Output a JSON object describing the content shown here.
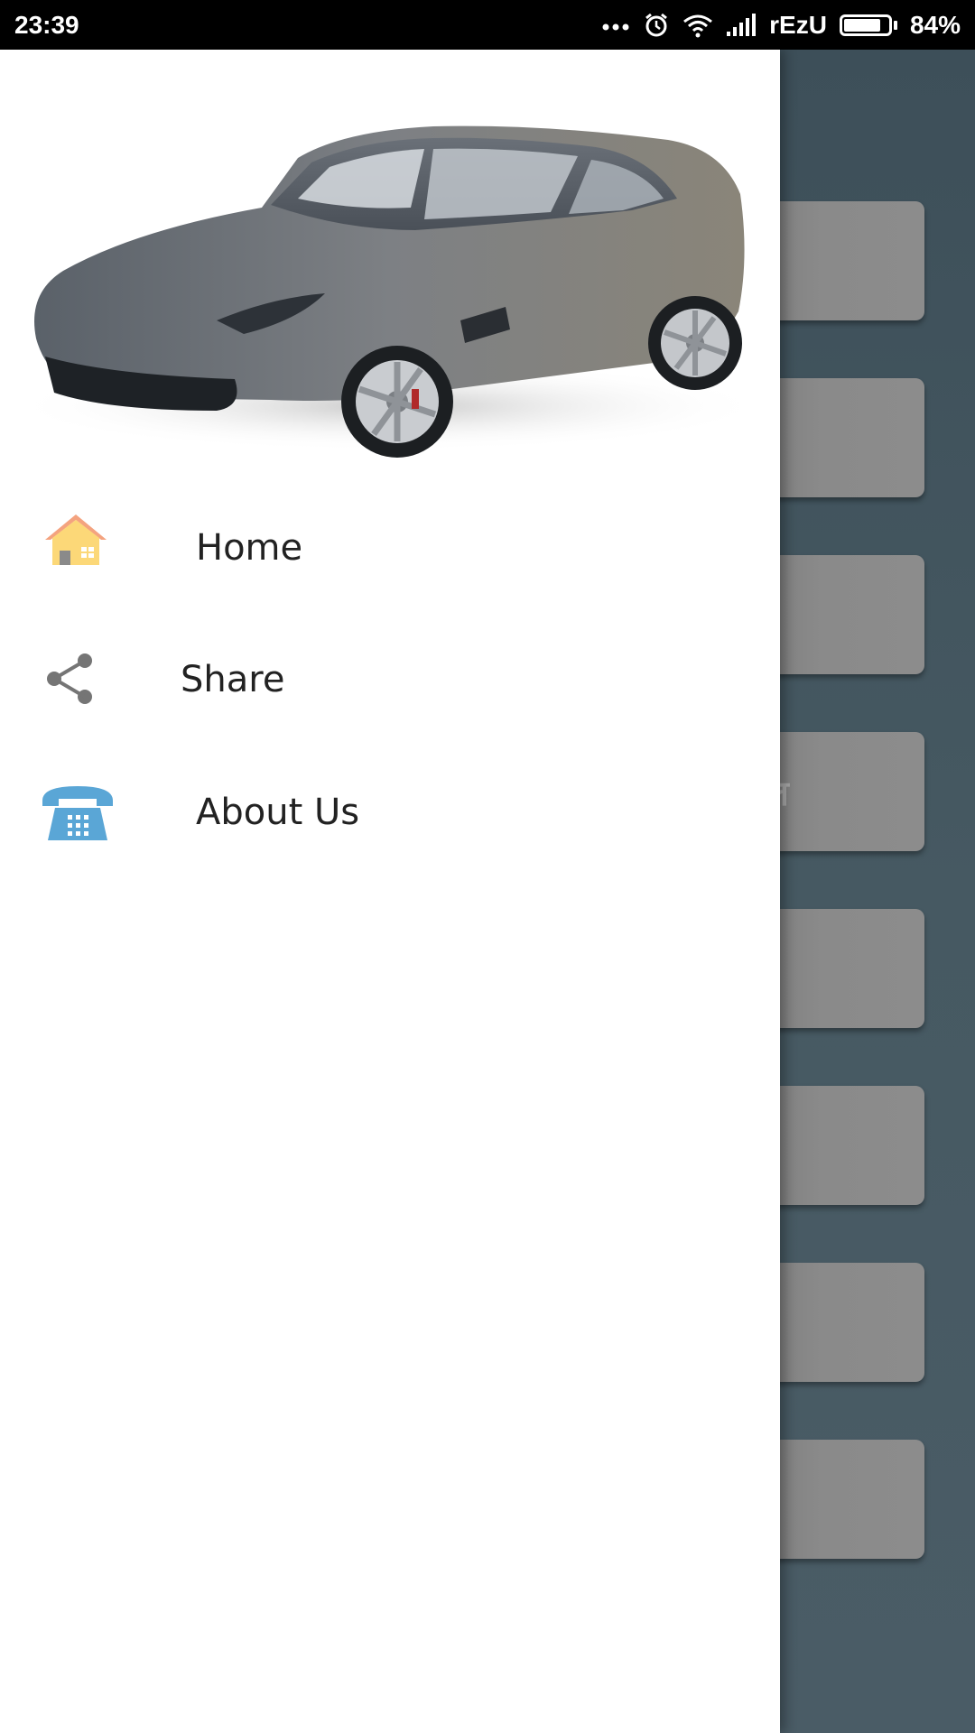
{
  "status_bar": {
    "time": "23:39",
    "dots": "...",
    "carrier": "rEzU",
    "battery_percent": "84%",
    "battery_level": 0.84
  },
  "drawer": {
    "header_image": "sports-car-image",
    "items": [
      {
        "label": "Home",
        "icon": "home-icon"
      },
      {
        "label": "Share",
        "icon": "share-icon"
      },
      {
        "label": "About Us",
        "icon": "telephone-icon"
      }
    ]
  },
  "background": {
    "button_fragment_text": "ल"
  },
  "colors": {
    "drawer_bg": "#ffffff",
    "scrim": "#4a5b64",
    "tile": "#8a8a8a",
    "home_roof": "#f4a37f",
    "home_wall": "#fcd878",
    "phone": "#5aa6d6",
    "share": "#757575"
  }
}
